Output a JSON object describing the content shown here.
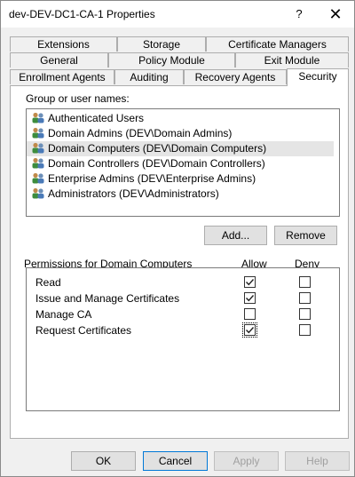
{
  "window": {
    "title": "dev-DEV-DC1-CA-1 Properties",
    "help_label": "?",
    "close_label": "✕"
  },
  "tabs": {
    "row1": [
      "Extensions",
      "Storage",
      "Certificate Managers"
    ],
    "row2": [
      "General",
      "Policy Module",
      "Exit Module"
    ],
    "row3": [
      "Enrollment Agents",
      "Auditing",
      "Recovery Agents",
      "Security"
    ],
    "active": "Security"
  },
  "security": {
    "group_label": "Group or user names:",
    "users": [
      "Authenticated Users",
      "Domain Admins (DEV\\Domain Admins)",
      "Domain Computers (DEV\\Domain Computers)",
      "Domain Controllers (DEV\\Domain Controllers)",
      "Enterprise Admins (DEV\\Enterprise Admins)",
      "Administrators (DEV\\Administrators)"
    ],
    "selected_user": "Domain Computers (DEV\\Domain Computers)",
    "add_label": "Add...",
    "remove_label": "Remove",
    "permissions_label": "Permissions for Domain Computers",
    "allow_header": "Allow",
    "deny_header": "Deny",
    "permissions": [
      {
        "name": "Read",
        "allow": true,
        "deny": false
      },
      {
        "name": "Issue and Manage Certificates",
        "allow": true,
        "deny": false
      },
      {
        "name": "Manage CA",
        "allow": false,
        "deny": false
      },
      {
        "name": "Request Certificates",
        "allow": true,
        "deny": false
      }
    ]
  },
  "footer": {
    "ok_label": "OK",
    "cancel_label": "Cancel",
    "apply_label": "Apply",
    "help_label": "Help"
  },
  "colors": {
    "accent": "#0078d7",
    "selection": "#e5e5e5"
  }
}
